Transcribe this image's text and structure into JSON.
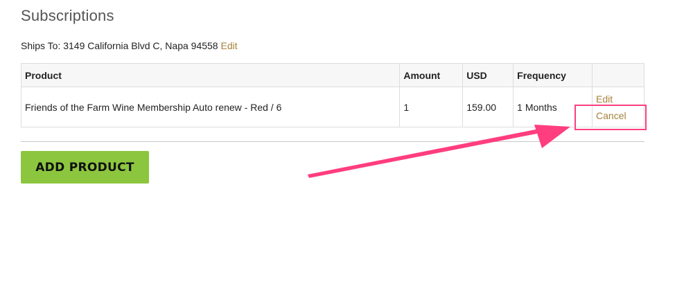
{
  "page": {
    "title": "Subscriptions"
  },
  "shipping": {
    "label": "Ships To: 3149 California Blvd C, Napa 94558",
    "edit_label": "Edit"
  },
  "table": {
    "headers": {
      "product": "Product",
      "amount": "Amount",
      "usd": "USD",
      "frequency": "Frequency",
      "actions": ""
    },
    "rows": [
      {
        "product": "Friends of the Farm Wine Membership Auto renew - Red / 6",
        "amount": "1",
        "usd": "159.00",
        "frequency": "1 Months",
        "edit_label": "Edit",
        "cancel_label": "Cancel"
      }
    ]
  },
  "actions": {
    "add_product_label": "ADD PRODUCT"
  },
  "colors": {
    "link": "#a6833a",
    "button": "#8cc63f",
    "annotation": "#ff3d7f"
  }
}
